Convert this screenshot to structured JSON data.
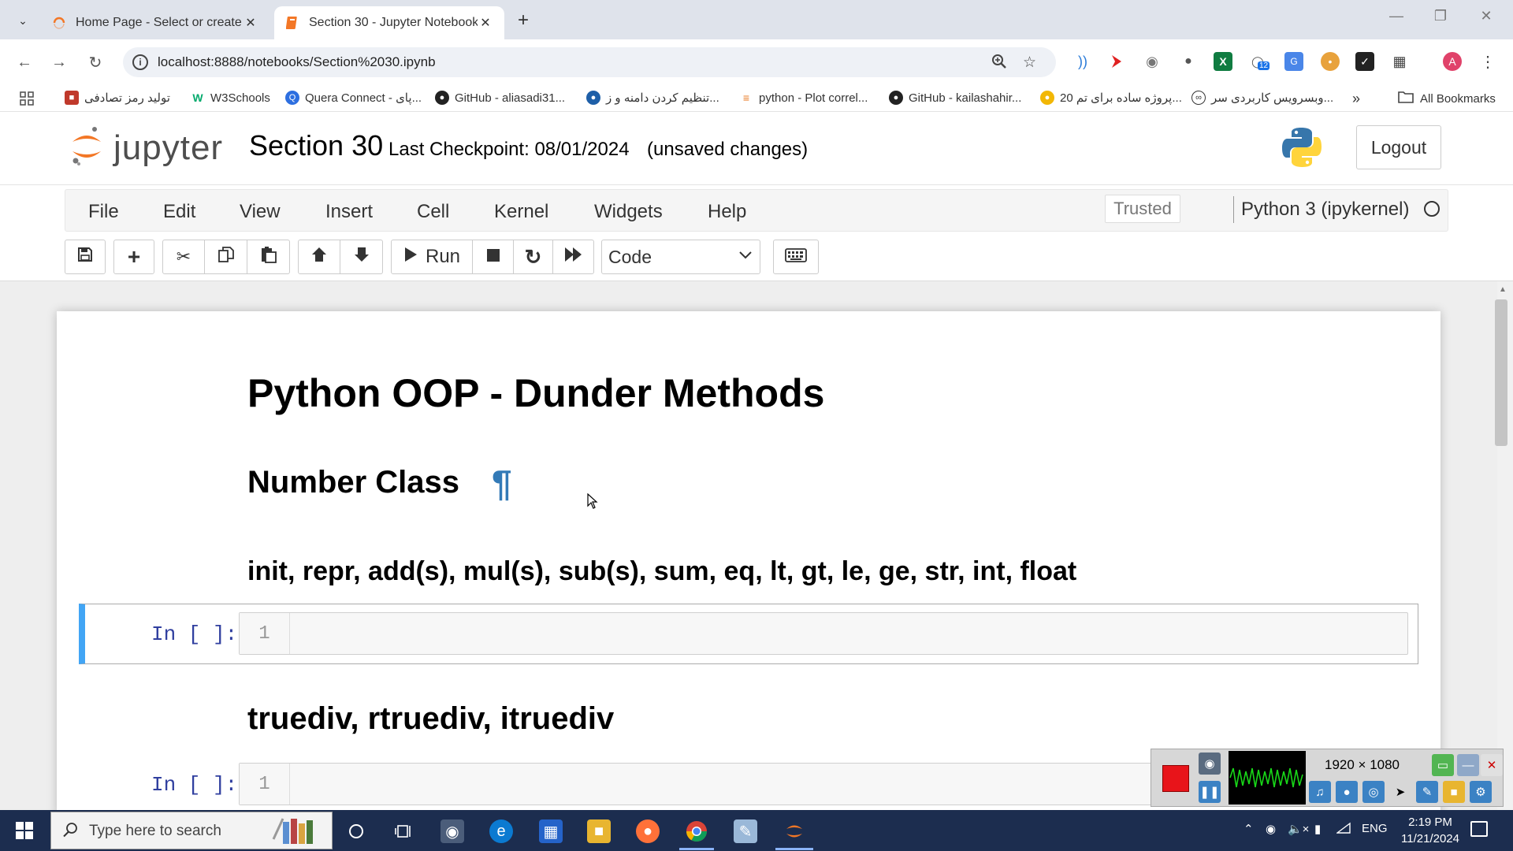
{
  "browser": {
    "tabs": [
      {
        "title": "Home Page - Select or create a notebook",
        "active": false
      },
      {
        "title": "Section 30 - Jupyter Notebook",
        "active": true
      }
    ],
    "url": "localhost:8888/notebooks/Section%2030.ipynb",
    "bookmarks": [
      "تولید رمز تصادفی",
      "W3Schools",
      "Quera Connect - پای...",
      "GitHub - aliasadi31...",
      "تنظیم کردن دامنه و ز...",
      "python - Plot correl...",
      "GitHub - kailashahir...",
      "20 پروژه ساده برای تم...",
      "وبسرویس کاربردی سر..."
    ],
    "all_bookmarks": "All Bookmarks",
    "extension_badge": "12",
    "profile_initial": "A"
  },
  "jupyter": {
    "logo_text": "jupyter",
    "notebook_name": "Section 30",
    "checkpoint": "Last Checkpoint: 08/01/2024",
    "unsaved": "(unsaved changes)",
    "logout": "Logout",
    "menu": [
      "File",
      "Edit",
      "View",
      "Insert",
      "Cell",
      "Kernel",
      "Widgets",
      "Help"
    ],
    "trusted": "Trusted",
    "kernel": "Python 3 (ipykernel)",
    "toolbar": {
      "run_label": "Run",
      "cell_type": "Code"
    }
  },
  "notebook": {
    "h1": "Python OOP - Dunder Methods",
    "h2": "Number Class",
    "pilcrow": "¶",
    "h3_a": "init, repr, add(s), mul(s), sub(s), sum, eq, lt, gt, le, ge, str, int, float",
    "h3_b": "truediv, rtruediv, itruediv",
    "cells": [
      {
        "prompt": "In [ ]:",
        "line": "1"
      },
      {
        "prompt": "In [ ]:",
        "line": "1"
      }
    ]
  },
  "recorder": {
    "resolution": "1920 × 1080"
  },
  "taskbar": {
    "search_placeholder": "Type here to search",
    "language": "ENG",
    "time": "2:19 PM",
    "date": "11/21/2024"
  }
}
